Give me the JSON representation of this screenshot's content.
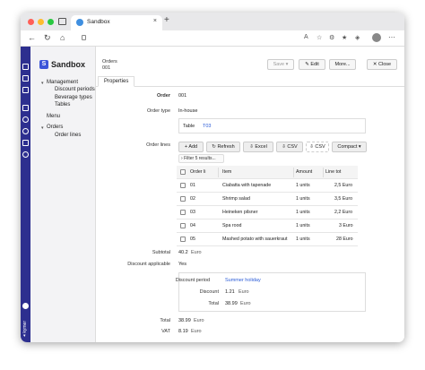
{
  "browser": {
    "tab_title": "Sandbox",
    "tab_close": "×",
    "new_tab": "+"
  },
  "app": {
    "badge": "S",
    "title": "Sandbox",
    "brand": "kymer"
  },
  "sidebar": {
    "management": "Management",
    "discount_periods": "Discount periods",
    "beverage_types": "Beverage types",
    "tables": "Tables",
    "menu": "Menu",
    "orders": "Orders",
    "order_lines": "Order lines"
  },
  "header": {
    "crumb_type": "Orders",
    "crumb_id": "001",
    "save": "Save",
    "edit": "Edit",
    "more": "More...",
    "close": "Close"
  },
  "tabs": {
    "properties": "Properties"
  },
  "form": {
    "order_label": "Order",
    "order_value": "001",
    "order_type_label": "Order type",
    "order_type_value": "In-house",
    "table_label": "Table",
    "table_value": "T03",
    "order_lines_label": "Order lines",
    "subtotal_label": "Subtotal",
    "subtotal_value": "40.2",
    "subtotal_unit": "Euro",
    "discount_applicable_label": "Discount applicable",
    "discount_applicable_value": "Yes",
    "discount_period_label": "Discount period",
    "discount_period_value": "Summer holiday",
    "discount_label": "Discount",
    "discount_value": "1.21",
    "discount_unit": "Euro",
    "inner_total_label": "Total",
    "inner_total_value": "38.99",
    "inner_total_unit": "Euro",
    "total_label": "Total",
    "total_value": "38.99",
    "total_unit": "Euro",
    "vat_label": "VAT",
    "vat_value": "8.19",
    "vat_unit": "Euro"
  },
  "toolbar": {
    "add": "Add",
    "refresh": "Refresh",
    "excel": "Excel",
    "csv": "CSV",
    "csv2": "CSV",
    "compact": "Compact",
    "filter": "Filter 5 results..."
  },
  "grid": {
    "columns": [
      "Order li",
      "Item",
      "Amount",
      "Line tot"
    ],
    "rows": [
      {
        "no": "01",
        "item": "Ciabatta with tapenade",
        "amount": "1 units",
        "total": "2,5 Euro"
      },
      {
        "no": "02",
        "item": "Shrimp salad",
        "amount": "1 units",
        "total": "3,5 Euro"
      },
      {
        "no": "03",
        "item": "Heineken pilsner",
        "amount": "1 units",
        "total": "2,2 Euro"
      },
      {
        "no": "04",
        "item": "Spa rood",
        "amount": "1 units",
        "total": "3 Euro"
      },
      {
        "no": "05",
        "item": "Mashed potato with sauerkraut",
        "amount": "1 units",
        "total": "28 Euro"
      }
    ]
  }
}
